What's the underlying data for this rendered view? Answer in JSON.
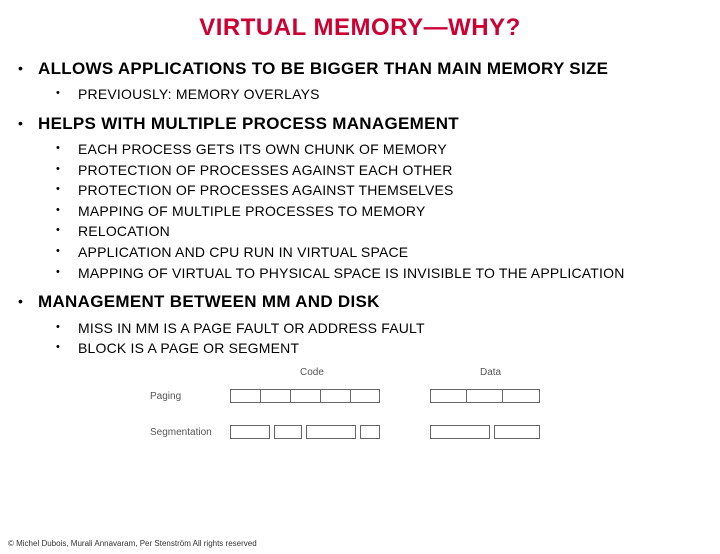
{
  "title": "VIRTUAL MEMORY—WHY?",
  "points": [
    {
      "hdr": "ALLOWS APPLICATIONS TO BE BIGGER THAN MAIN MEMORY SIZE",
      "sub": [
        "PREVIOUSLY: MEMORY OVERLAYS"
      ]
    },
    {
      "hdr": "HELPS WITH MULTIPLE PROCESS MANAGEMENT",
      "sub": [
        "EACH PROCESS GETS ITS OWN CHUNK OF MEMORY",
        "PROTECTION OF PROCESSES AGAINST EACH OTHER",
        "PROTECTION OF PROCESSES AGAINST THEMSELVES",
        "MAPPING OF MULTIPLE PROCESSES TO MEMORY",
        "RELOCATION",
        "APPLICATION AND CPU RUN IN VIRTUAL SPACE",
        "MAPPING OF VIRTUAL TO PHYSICAL SPACE IS INVISIBLE TO THE APPLICATION"
      ]
    },
    {
      "hdr": "MANAGEMENT BETWEEN MM AND DISK",
      "sub": [
        "MISS IN MM IS A PAGE FAULT OR ADDRESS FAULT",
        "BLOCK IS A PAGE OR SEGMENT"
      ]
    }
  ],
  "diagram": {
    "top_left_label": "Code",
    "top_right_label": "Data",
    "row1_label": "Paging",
    "row2_label": "Segmentation"
  },
  "footer": "© Michel Dubois, Murali Annavaram, Per Stenström All rights reserved"
}
